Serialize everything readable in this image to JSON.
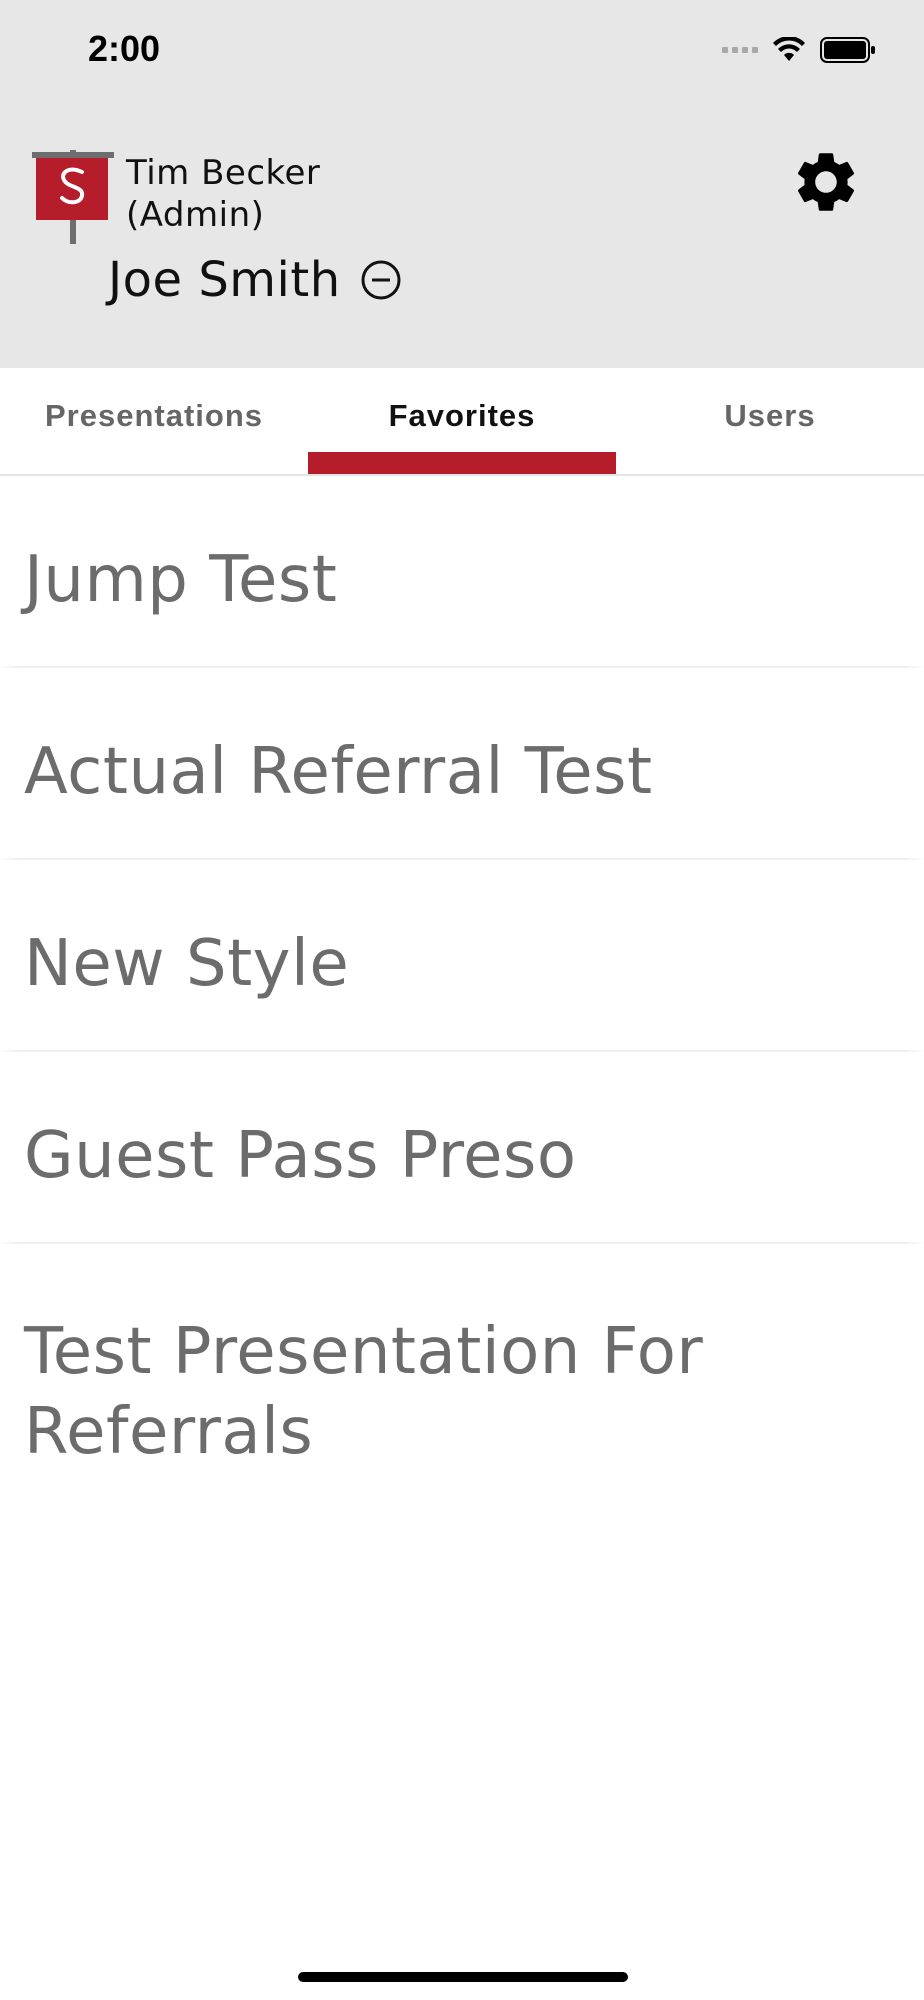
{
  "status_bar": {
    "time": "2:00"
  },
  "header": {
    "user_name": "Tim Becker (Admin)",
    "client_name": "Joe Smith",
    "icons": [
      "app-logo-icon",
      "gear-icon",
      "remove-circle-icon"
    ]
  },
  "tabs": [
    {
      "label": "Presentations",
      "active": false
    },
    {
      "label": "Favorites",
      "active": true
    },
    {
      "label": "Users",
      "active": false
    }
  ],
  "favorites": [
    "Jump Test",
    "Actual Referral Test",
    "New Style",
    "Guest Pass Preso",
    "Test Presentation For Referrals"
  ],
  "colors": {
    "accent": "#b61d2a",
    "header_bg": "#e7e7e7",
    "item_text": "#6c6c6c"
  }
}
